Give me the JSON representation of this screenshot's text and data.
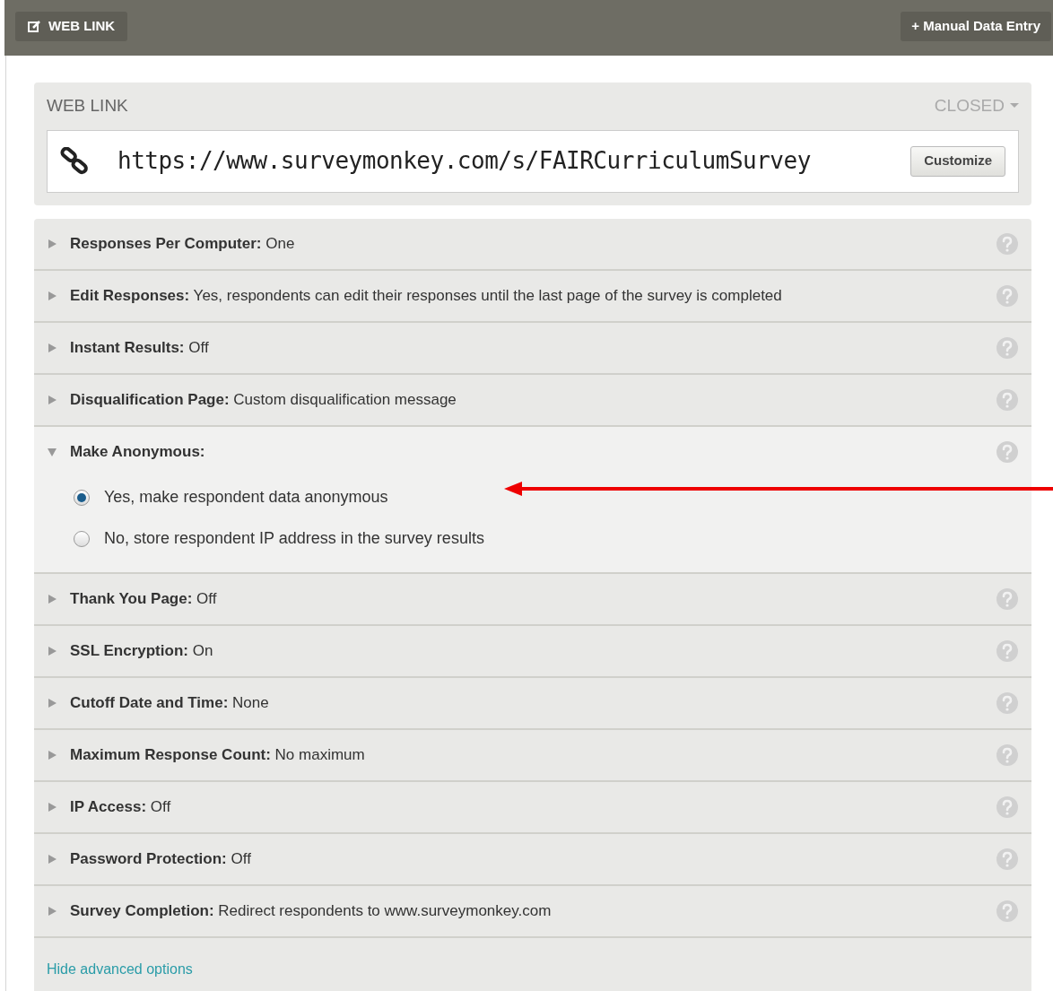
{
  "toolbar": {
    "web_link_button": "WEB LINK",
    "manual_entry_button": "+ Manual Data Entry"
  },
  "web_link": {
    "title": "WEB LINK",
    "status": "CLOSED",
    "url": "https://www.surveymonkey.com/s/FAIRCurriculumSurvey",
    "customize_button": "Customize"
  },
  "settings": [
    {
      "label": "Responses Per Computer:",
      "value": "One",
      "expanded": false
    },
    {
      "label": "Edit Responses:",
      "value": "Yes, respondents can edit their responses until the last page of the survey is completed",
      "expanded": false
    },
    {
      "label": "Instant Results:",
      "value": "Off",
      "expanded": false
    },
    {
      "label": "Disqualification Page:",
      "value": "Custom disqualification message",
      "expanded": false
    },
    {
      "label": "Make Anonymous:",
      "expanded": true,
      "options": [
        {
          "label": "Yes, make respondent data anonymous",
          "selected": true
        },
        {
          "label": "No, store respondent IP address in the survey results",
          "selected": false
        }
      ]
    },
    {
      "label": "Thank You Page:",
      "value": "Off",
      "expanded": false
    },
    {
      "label": "SSL Encryption:",
      "value": "On",
      "expanded": false
    },
    {
      "label": "Cutoff Date and Time:",
      "value": "None",
      "expanded": false
    },
    {
      "label": "Maximum Response Count:",
      "value": "No maximum",
      "expanded": false
    },
    {
      "label": "IP Access:",
      "value": "Off",
      "expanded": false
    },
    {
      "label": "Password Protection:",
      "value": "Off",
      "expanded": false
    },
    {
      "label": "Survey Completion:",
      "value": "Redirect respondents to www.surveymonkey.com",
      "expanded": false
    }
  ],
  "hide_advanced_link": "Hide advanced options"
}
